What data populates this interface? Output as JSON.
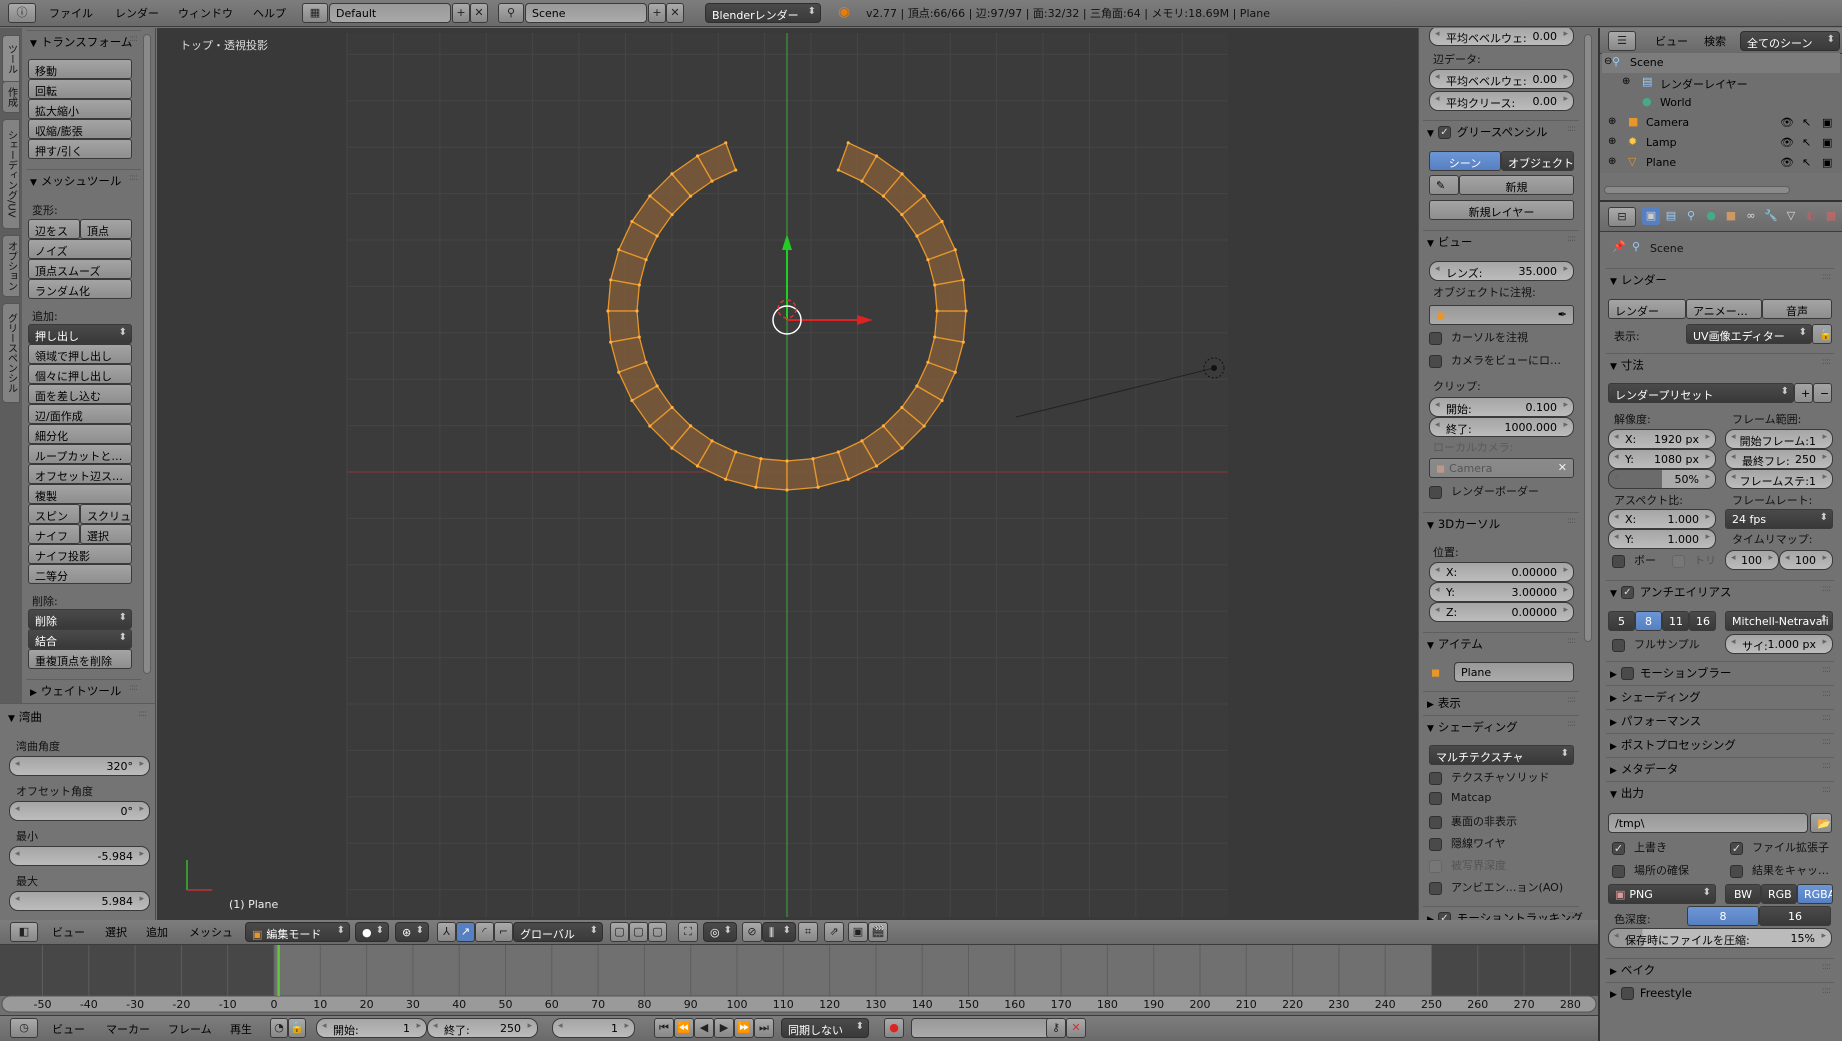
{
  "topbar": {
    "menus": [
      "ファイル",
      "レンダー",
      "ウィンドウ",
      "ヘルプ"
    ],
    "layout": "Default",
    "scene": "Scene",
    "engine": "Blenderレンダー",
    "stats": "v2.77 | 頂点:66/66 | 辺:97/97 | 面:32/32 | 三角面:64 | メモリ:18.69M | Plane"
  },
  "tool_shelf": {
    "tabs": [
      "ツール",
      "作成",
      "シェーディング/UV",
      "オプション",
      "グリースペンシル"
    ],
    "transform_title": "トランスフォーム",
    "transform_items": [
      "移動",
      "回転",
      "拡大縮小",
      "収縮/膨張",
      "押す/引く"
    ],
    "mesh_tools_title": "メッシュツール",
    "deform_label": "変形:",
    "deform_items": [
      "辺をス",
      "頂点",
      "ノイズ",
      "頂点スムーズ",
      "ランダム化"
    ],
    "add_label": "追加:",
    "add_items": [
      "押し出し",
      "領域で押し出し",
      "個々に押し出し",
      "面を差し込む",
      "辺/面作成",
      "細分化",
      "ループカットと…",
      "オフセット辺ス…",
      "複製",
      "スピン",
      "スクリュ",
      "ナイフ",
      "選択",
      "ナイフ投影",
      "二等分"
    ],
    "delete_label": "削除:",
    "delete_items": [
      "削除",
      "結合",
      "重複頂点を削除"
    ],
    "weight_tools_title": "ウェイトツール"
  },
  "redo_panel": {
    "title": "湾曲",
    "fields": [
      {
        "label": "湾曲角度",
        "value": "320°"
      },
      {
        "label": "オフセット角度",
        "value": "0°"
      },
      {
        "label": "最小",
        "value": "-5.984"
      },
      {
        "label": "最大",
        "value": "5.984"
      }
    ]
  },
  "viewport": {
    "view_label": "トップ・透視投影",
    "object_label": "(1) Plane",
    "bend_angle_deg": 320,
    "segments": 32,
    "mesh_color": "#e8962a",
    "grid_color": "#454545",
    "bg_color": "#393939"
  },
  "npanel": {
    "mean_bevel_weight_label": "平均ベベルウェ:",
    "mean_bevel_weight": "0.00",
    "edge_data_label": "辺データ:",
    "edge_bevel_label": "平均ベベルウェ:",
    "edge_bevel": "0.00",
    "crease_label": "平均クリース:",
    "crease": "0.00",
    "grease_title": "グリースペンシル",
    "grease_scene": "シーン",
    "grease_object": "オブジェクト",
    "grease_new": "新規",
    "grease_new_layer": "新規レイヤー",
    "view_title": "ビュー",
    "lens_label": "レンズ:",
    "lens": "35.000",
    "lock_object_label": "オブジェクトに注視:",
    "lock_cursor": "カーソルを注視",
    "lock_camera": "カメラをビューにロ…",
    "clip_label": "クリップ:",
    "clip_start_label": "開始:",
    "clip_start": "0.100",
    "clip_end_label": "終了:",
    "clip_end": "1000.000",
    "local_camera_label": "ローカルカメラ:",
    "local_camera": "Camera",
    "render_border": "レンダーボーダー",
    "cursor_title": "3Dカーソル",
    "location_label": "位置:",
    "cursor_x_label": "X:",
    "cursor_x": "0.00000",
    "cursor_y_label": "Y:",
    "cursor_y": "3.00000",
    "cursor_z_label": "Z:",
    "cursor_z": "0.00000",
    "item_title": "アイテム",
    "item_name": "Plane",
    "display_title": "表示",
    "shading_title": "シェーディング",
    "shading_mode": "マルチテクスチャ",
    "shading_checks": [
      "テクスチャソリッド",
      "Matcap",
      "裏面の非表示",
      "隠線ワイヤ",
      "被写界深度",
      "アンビエン…ョン(AO)"
    ],
    "motion_tracking": "モーショントラッキング"
  },
  "outliner": {
    "menu_view": "ビュー",
    "menu_search": "検索",
    "display_mode": "全てのシーン",
    "items": [
      "Scene",
      "レンダーレイヤー",
      "World",
      "Camera",
      "Lamp",
      "Plane"
    ]
  },
  "properties": {
    "context": "Scene",
    "render_title": "レンダー",
    "render_btn": "レンダー",
    "anim_btn": "アニメー…",
    "audio_btn": "音声",
    "display_label": "表示:",
    "display_value": "UV画像エディター",
    "dimensions_title": "寸法",
    "preset": "レンダープリセット",
    "resolution_label": "解像度:",
    "res_x_label": "X:",
    "res_x": "1920 px",
    "res_y_label": "Y:",
    "res_y": "1080 px",
    "res_pct": "50%",
    "res_pct_fraction": 0.5,
    "frame_range_label": "フレーム範囲:",
    "frame_start": "開始フレーム:1",
    "frame_end_label": "最終フレ:",
    "frame_end": "250",
    "frame_step": "フレームステ:1",
    "aspect_label": "アスペクト比:",
    "aspect_x_label": "X:",
    "aspect_x": "1.000",
    "aspect_y_label": "Y:",
    "aspect_y": "1.000",
    "framerate_label": "フレームレート:",
    "framerate": "24 fps",
    "border_label": "ボー",
    "crop_label": "トリ",
    "time_remap_label": "タイムリマップ:",
    "remap_old": "100",
    "remap_new": "100",
    "aa_title": "アンチエイリアス",
    "aa_samples": [
      "5",
      "8",
      "11",
      "16"
    ],
    "aa_selected": "8",
    "aa_filter": "Mitchell-Netravali",
    "full_sample": "フルサンプル",
    "filter_size_label": "サイ:",
    "filter_size": "1.000 px",
    "collapsed_panels": [
      "モーションブラー",
      "シェーディング",
      "パフォーマンス",
      "ポストプロセッシング",
      "メタデータ"
    ],
    "output_title": "出力",
    "output_path": "/tmp\\",
    "overwrite": "上書き",
    "file_ext": "ファイル拡張子",
    "placeholders": "場所の確保",
    "cache_result": "結果をキャッ…",
    "format": "PNG",
    "color_modes": [
      "BW",
      "RGB",
      "RGBA"
    ],
    "color_mode_selected": "RGBA",
    "color_depth_label": "色深度:",
    "color_depths": [
      "8",
      "16"
    ],
    "color_depth_selected": "8",
    "compression_label": "保存時にファイルを圧縮:",
    "compression": "15%",
    "compression_fraction": 0.15,
    "bake_title": "ベイク",
    "freestyle_title": "Freestyle"
  },
  "view3d_header": {
    "menus": [
      "ビュー",
      "選択",
      "追加",
      "メッシュ"
    ],
    "mode": "編集モード",
    "orientation": "グローバル"
  },
  "timeline": {
    "ticks": [
      "-50",
      "-40",
      "-30",
      "-20",
      "-10",
      "0",
      "10",
      "20",
      "30",
      "40",
      "50",
      "60",
      "70",
      "80",
      "90",
      "100",
      "110",
      "120",
      "130",
      "140",
      "150",
      "160",
      "170",
      "180",
      "190",
      "200",
      "210",
      "220",
      "230",
      "240",
      "250",
      "260",
      "270",
      "280"
    ],
    "current_frame": 1,
    "range_start": 1,
    "range_end": 250,
    "menus": [
      "ビュー",
      "マーカー",
      "フレーム",
      "再生"
    ],
    "start_label": "開始:",
    "start": "1",
    "end_label": "終了:",
    "end": "250",
    "current": "1",
    "sync": "同期しない"
  }
}
